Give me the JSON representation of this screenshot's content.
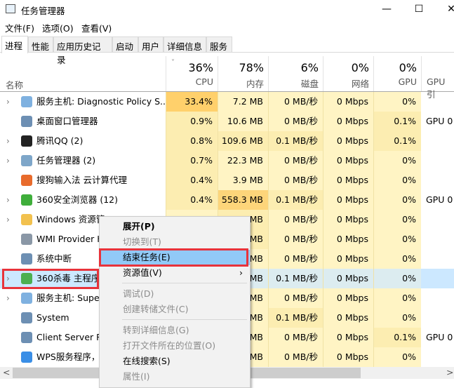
{
  "window": {
    "title": "任务管理器",
    "minimize": "—",
    "maximize": "☐",
    "close": "✕"
  },
  "menubar": [
    "文件(F)",
    "选项(O)",
    "查看(V)"
  ],
  "tabs": [
    "进程",
    "性能",
    "应用历史记录",
    "启动",
    "用户",
    "详细信息",
    "服务"
  ],
  "header": {
    "name": "名称",
    "sort_icon": "chevron-down",
    "columns": [
      {
        "pct": "36%",
        "label": "CPU"
      },
      {
        "pct": "78%",
        "label": "内存"
      },
      {
        "pct": "6%",
        "label": "磁盘"
      },
      {
        "pct": "0%",
        "label": "网络"
      },
      {
        "pct": "0%",
        "label": "GPU"
      },
      {
        "pct": "",
        "label": "GPU 引"
      }
    ]
  },
  "rows": [
    {
      "name": "服务主机: Diagnostic Policy S...",
      "expand": true,
      "icon": "gear",
      "cpu": "33.4%",
      "mem": "7.2 MB",
      "disk": "0 MB/秒",
      "net": "0 Mbps",
      "gpu": "0%",
      "eng": ""
    },
    {
      "name": "桌面窗口管理器",
      "expand": false,
      "icon": "window",
      "cpu": "0.9%",
      "mem": "10.6 MB",
      "disk": "0 MB/秒",
      "net": "0 Mbps",
      "gpu": "0.1%",
      "eng": "GPU 0"
    },
    {
      "name": "腾讯QQ (2)",
      "expand": true,
      "icon": "qq",
      "cpu": "0.8%",
      "mem": "109.6 MB",
      "disk": "0.1 MB/秒",
      "net": "0 Mbps",
      "gpu": "0.1%",
      "eng": ""
    },
    {
      "name": "任务管理器 (2)",
      "expand": true,
      "icon": "taskmgr",
      "cpu": "0.7%",
      "mem": "22.3 MB",
      "disk": "0 MB/秒",
      "net": "0 Mbps",
      "gpu": "0%",
      "eng": ""
    },
    {
      "name": "搜狗输入法 云计算代理",
      "expand": false,
      "icon": "sogou",
      "cpu": "0.4%",
      "mem": "3.9 MB",
      "disk": "0 MB/秒",
      "net": "0 Mbps",
      "gpu": "0%",
      "eng": ""
    },
    {
      "name": "360安全浏览器 (12)",
      "expand": true,
      "icon": "browser360",
      "cpu": "0.4%",
      "mem": "558.3 MB",
      "disk": "0.1 MB/秒",
      "net": "0 Mbps",
      "gpu": "0%",
      "eng": "GPU 0"
    },
    {
      "name": "Windows 资源管",
      "expand": true,
      "icon": "folder",
      "cpu": "",
      "mem": "MB",
      "disk": "0 MB/秒",
      "net": "0 Mbps",
      "gpu": "0%",
      "eng": ""
    },
    {
      "name": "WMI Provider H",
      "expand": false,
      "icon": "wmi",
      "cpu": "",
      "mem": "MB",
      "disk": "0 MB/秒",
      "net": "0 Mbps",
      "gpu": "0%",
      "eng": ""
    },
    {
      "name": "系统中断",
      "expand": false,
      "icon": "window",
      "cpu": "",
      "mem": "MB",
      "disk": "0 MB/秒",
      "net": "0 Mbps",
      "gpu": "0%",
      "eng": ""
    },
    {
      "name": "360杀毒 主程序",
      "expand": true,
      "icon": "shield360",
      "cpu": "",
      "mem": "MB",
      "disk": "0.1 MB/秒",
      "net": "0 Mbps",
      "gpu": "0%",
      "eng": "",
      "selected": true
    },
    {
      "name": "服务主机: Super",
      "expand": true,
      "icon": "gear",
      "cpu": "",
      "mem": "MB",
      "disk": "0 MB/秒",
      "net": "0 Mbps",
      "gpu": "0%",
      "eng": ""
    },
    {
      "name": "System",
      "expand": false,
      "icon": "window",
      "cpu": "",
      "mem": "MB",
      "disk": "0.1 MB/秒",
      "net": "0 Mbps",
      "gpu": "0%",
      "eng": ""
    },
    {
      "name": "Client Server Ru",
      "expand": false,
      "icon": "window",
      "cpu": "",
      "mem": "MB",
      "disk": "0 MB/秒",
      "net": "0 Mbps",
      "gpu": "0.1%",
      "eng": "GPU 0"
    },
    {
      "name": "WPS服务程序，拉",
      "expand": false,
      "icon": "cloud",
      "cpu": "",
      "mem": "MB",
      "disk": "0 MB/秒",
      "net": "0 Mbps",
      "gpu": "0%",
      "eng": ""
    }
  ],
  "context_menu": [
    {
      "label": "展开(P)",
      "state": "bold"
    },
    {
      "label": "切换到(T)",
      "state": "disabled"
    },
    {
      "label": "结束任务(E)",
      "state": "highlighted"
    },
    {
      "label": "资源值(V)",
      "state": "normal",
      "submenu": true
    },
    {
      "sep": true
    },
    {
      "label": "调试(D)",
      "state": "disabled"
    },
    {
      "label": "创建转储文件(C)",
      "state": "disabled"
    },
    {
      "sep": true
    },
    {
      "label": "转到详细信息(G)",
      "state": "disabled"
    },
    {
      "label": "打开文件所在的位置(O)",
      "state": "disabled"
    },
    {
      "label": "在线搜索(S)",
      "state": "normal"
    },
    {
      "label": "属性(I)",
      "state": "disabled"
    }
  ],
  "colors": {
    "cpu_high": "#ffd06b",
    "mem_high": "#fdd57a",
    "heat_low": "#fff4c4",
    "heat_mid": "#fcedb1",
    "selected": "#cce8ff",
    "menu_highlight": "#91c9f7",
    "annotation": "#e8333b"
  }
}
